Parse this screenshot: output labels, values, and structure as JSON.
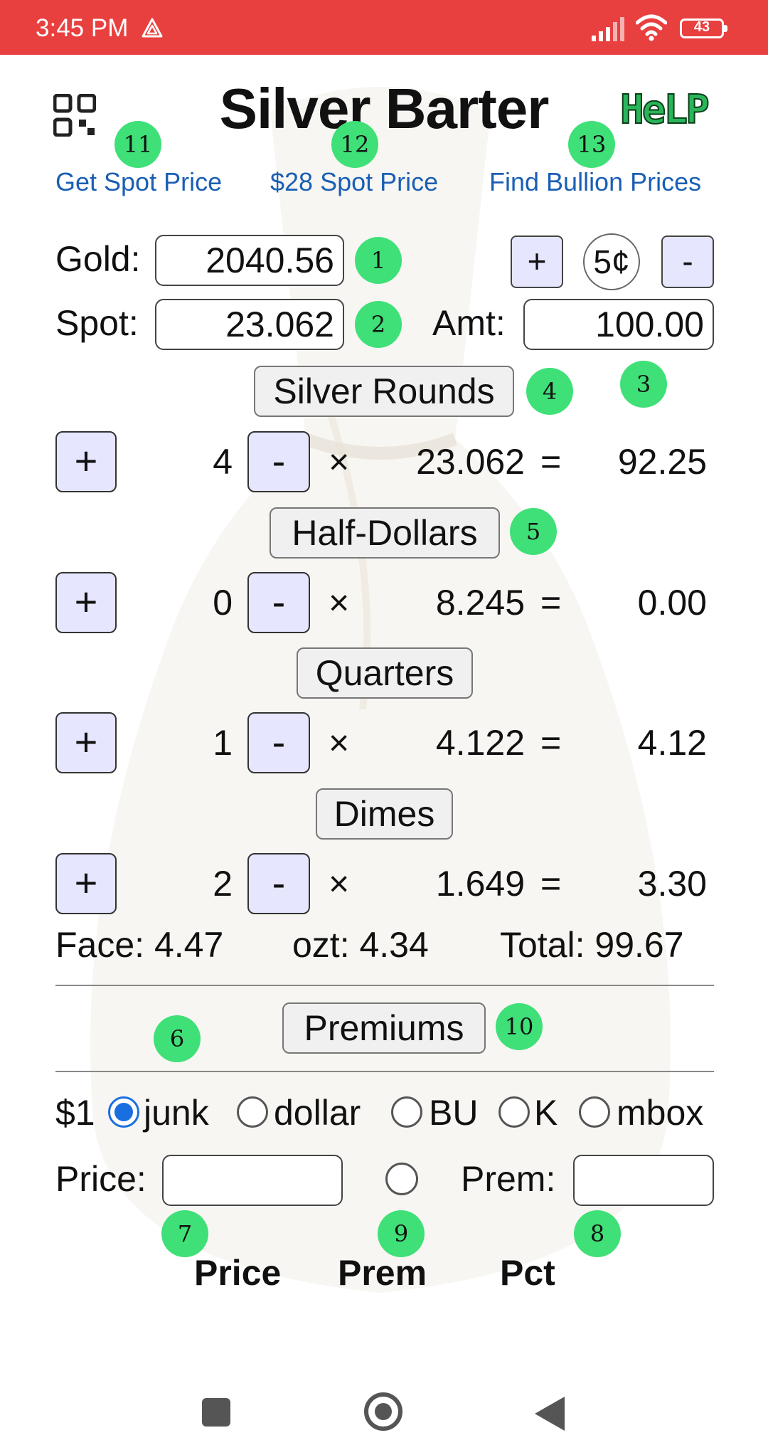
{
  "status_bar": {
    "time": "3:45 PM",
    "battery": "43"
  },
  "header": {
    "title": "Silver Barter",
    "help_label": "HeLP",
    "links": {
      "get_spot": "Get Spot Price",
      "spot_28": "$28 Spot Price",
      "find_bullion": "Find Bullion Prices"
    }
  },
  "badges": {
    "b1": "1",
    "b2": "2",
    "b3": "3",
    "b4": "4",
    "b5": "5",
    "b6": "6",
    "b7": "7",
    "b8": "8",
    "b9": "9",
    "b10": "10",
    "b11": "11",
    "b12": "12",
    "b13": "13"
  },
  "prices": {
    "gold_label": "Gold:",
    "gold_value": "2040.56",
    "spot_label": "Spot:",
    "spot_value": "23.062",
    "amt_label": "Amt:",
    "amt_value": "100.00",
    "plus_label": "+",
    "step_label": "5¢",
    "minus_label": "-"
  },
  "coins": [
    {
      "name": "Silver Rounds",
      "count": "4",
      "price": "23.062",
      "value": "92.25"
    },
    {
      "name": "Half-Dollars",
      "count": "0",
      "price": "8.245",
      "value": "0.00"
    },
    {
      "name": "Quarters",
      "count": "1",
      "price": "4.122",
      "value": "4.12"
    },
    {
      "name": "Dimes",
      "count": "2",
      "price": "1.649",
      "value": "3.30"
    }
  ],
  "ops": {
    "plus": "+",
    "minus": "-",
    "times": "×",
    "equals": "="
  },
  "totals": {
    "face": "Face: 4.47",
    "ozt": "ozt: 4.34",
    "total": "Total: 99.67"
  },
  "premiums": {
    "button": "Premiums",
    "dollar_label": "$1",
    "options": [
      {
        "label": "junk",
        "selected": true
      },
      {
        "label": "dollar",
        "selected": false
      },
      {
        "label": "BU",
        "selected": false
      },
      {
        "label": "K",
        "selected": false
      },
      {
        "label": "mbox",
        "selected": false
      }
    ],
    "price_label": "Price:",
    "price_value": "",
    "prem_label": "Prem:",
    "prem_value": ""
  },
  "table_headers": [
    "Price",
    "Prem",
    "Pct"
  ],
  "colors": {
    "status_bar": "#e8403f",
    "link": "#1a5fb4",
    "badge": "#3fe078",
    "stepper_bg": "#e6e6ff",
    "radio_selected": "#1a6fe0"
  }
}
